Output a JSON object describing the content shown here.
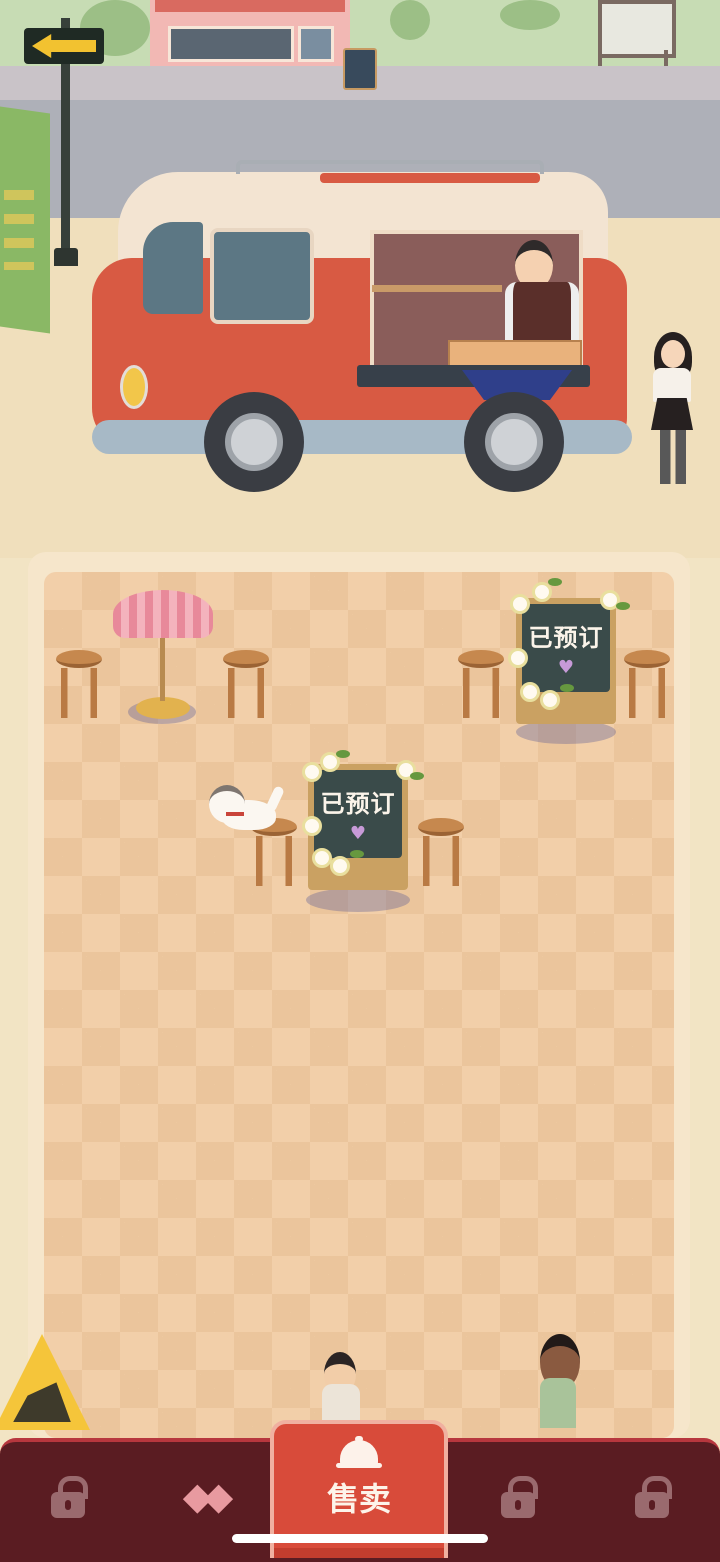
{
  "tables": [
    {
      "id": "table-mid",
      "status": "reserved",
      "sign_text": "已预订"
    },
    {
      "id": "table-right",
      "status": "reserved",
      "sign_text": "已预订"
    }
  ],
  "bottom_nav": {
    "items": [
      {
        "icon": "lock-icon",
        "locked": true
      },
      {
        "icon": "hands-icon",
        "locked": false
      },
      {
        "icon": "bell-icon",
        "label": "售卖",
        "active": true
      },
      {
        "icon": "lock-icon",
        "locked": true
      },
      {
        "icon": "lock-icon",
        "locked": true
      }
    ],
    "sell_label": "售卖"
  },
  "colors": {
    "van_red": "#d85a43",
    "sell_tab": "#d84b3a",
    "bottom_bar": "#5a1c22",
    "floor": "#f2cfa9"
  }
}
